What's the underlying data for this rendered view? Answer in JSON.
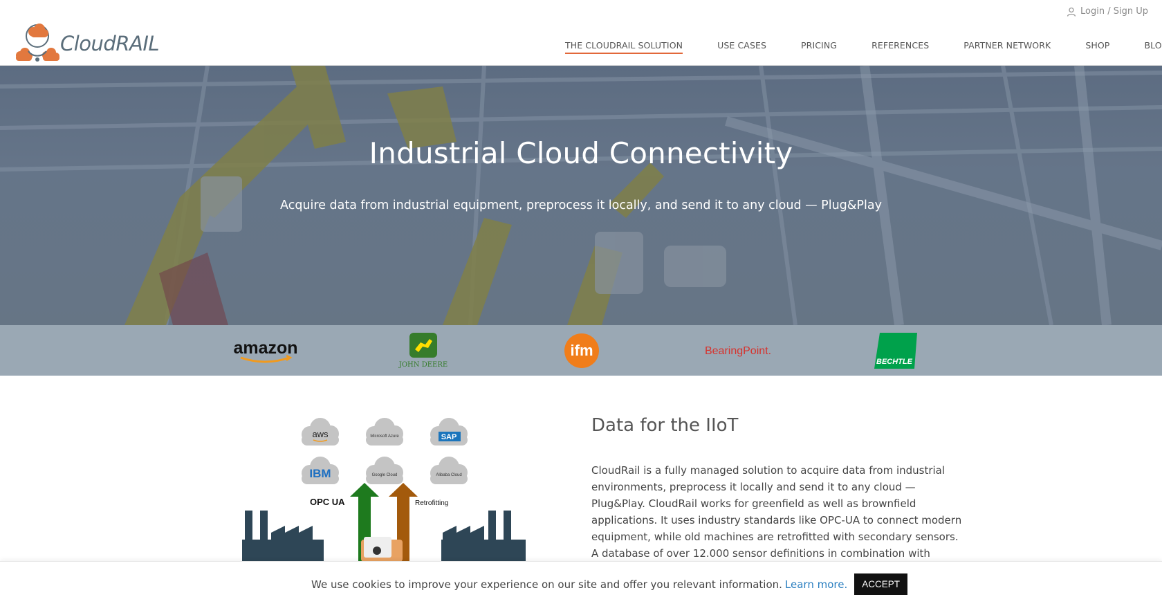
{
  "header": {
    "login_label": "Login / Sign Up",
    "logo_text": "CloudRAIL",
    "nav": [
      {
        "label": "THE CLOUDRAIL SOLUTION",
        "active": true
      },
      {
        "label": "USE CASES"
      },
      {
        "label": "PRICING"
      },
      {
        "label": "REFERENCES"
      },
      {
        "label": "PARTNER NETWORK"
      },
      {
        "label": "SHOP"
      },
      {
        "label": "BLOG"
      }
    ],
    "accent_color": "#e2683a"
  },
  "hero": {
    "title": "Industrial Cloud Connectivity",
    "subtitle": "Acquire data from industrial equipment, preprocess it locally, and send it to any cloud — Plug&Play"
  },
  "partners": {
    "amazon": "amazon",
    "john_deere": "JOHN DEERE",
    "ifm": "ifm",
    "bearingpoint": "BearingPoint.",
    "bechtle": "BECHTLE"
  },
  "illustration": {
    "clouds": [
      "aws",
      "Microsoft Azure",
      "SAP",
      "IBM",
      "Google Cloud",
      "Alibaba Cloud"
    ],
    "opc_label": "OPC UA",
    "retrofit_label": "Retrofitting"
  },
  "content": {
    "title": "Data for the IIoT",
    "body": "CloudRail is a fully managed solution to acquire data from industrial environments, preprocess it locally and send it to any cloud — Plug&Play. CloudRail works for greenfield as well as brownfield applications. It uses industry standards like OPC-UA to connect modern equipment, while old machines are retrofitted with secondary sensors. A database of over 12.000 sensor definitions in combination with automated data normalization and"
  },
  "cookie": {
    "text": "We use cookies to improve your experience on our site and offer you relevant information.",
    "link": "Learn more.",
    "accept": "ACCEPT"
  }
}
